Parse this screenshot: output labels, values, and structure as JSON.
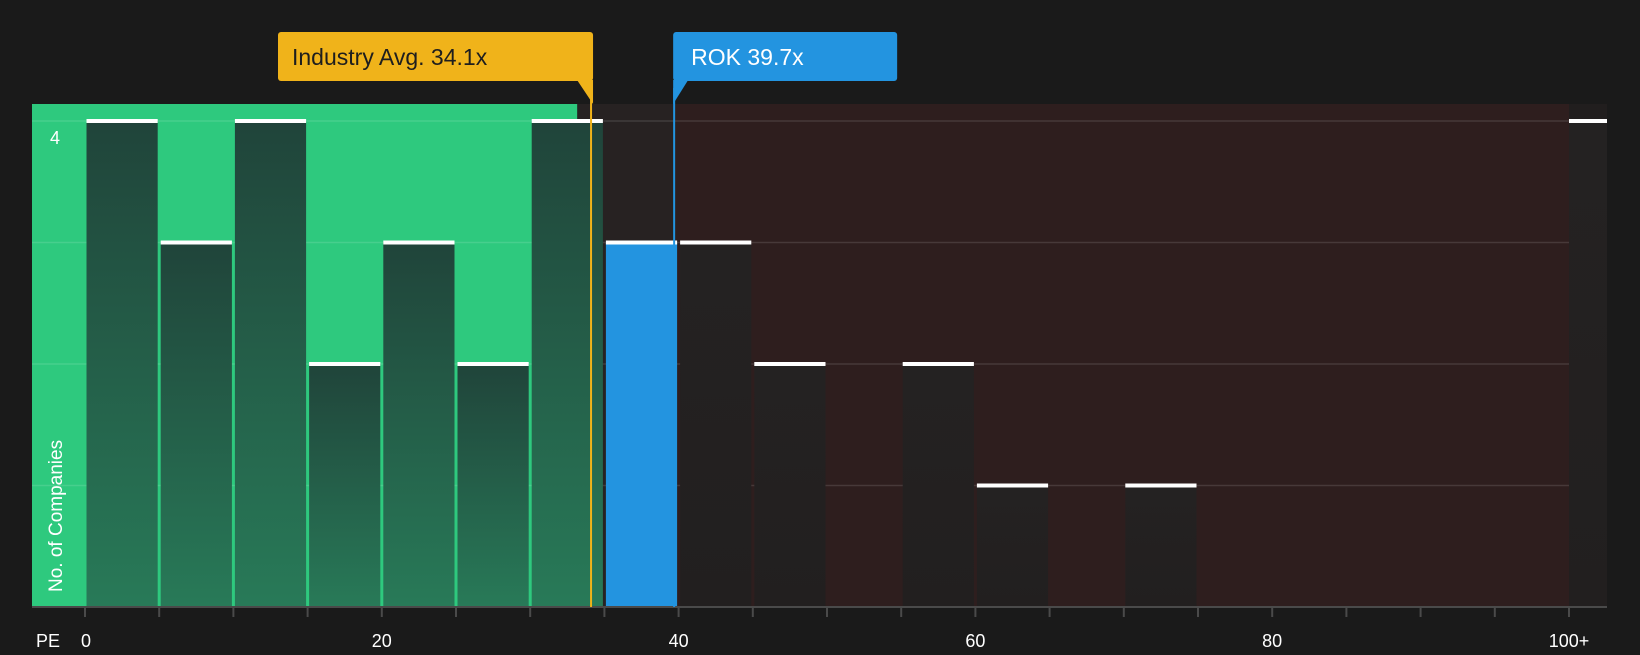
{
  "chart_data": {
    "type": "bar",
    "title": "",
    "xlabel": "PE",
    "ylabel": "No. of Companies",
    "x_ticks": [
      "0",
      "20",
      "40",
      "60",
      "80",
      "100+"
    ],
    "y_tick_labels": [
      "4"
    ],
    "ylim": [
      0,
      4
    ],
    "bin_width": 5,
    "bins": [
      {
        "start": 0,
        "count": 4,
        "zone": "below"
      },
      {
        "start": 5,
        "count": 3,
        "zone": "below"
      },
      {
        "start": 10,
        "count": 4,
        "zone": "below"
      },
      {
        "start": 15,
        "count": 2,
        "zone": "below"
      },
      {
        "start": 20,
        "count": 3,
        "zone": "below"
      },
      {
        "start": 25,
        "count": 2,
        "zone": "below"
      },
      {
        "start": 30,
        "count": 4,
        "zone": "below"
      },
      {
        "start": 35,
        "count": 3,
        "zone": "highlight"
      },
      {
        "start": 40,
        "count": 3,
        "zone": "above"
      },
      {
        "start": 45,
        "count": 2,
        "zone": "above"
      },
      {
        "start": 55,
        "count": 2,
        "zone": "above"
      },
      {
        "start": 60,
        "count": 1,
        "zone": "above"
      },
      {
        "start": 70,
        "count": 1,
        "zone": "above"
      },
      {
        "start": 100,
        "count": 4,
        "zone": "overflow"
      }
    ],
    "industry_avg": {
      "value": 34.1,
      "label": "Industry Avg. 34.1x"
    },
    "company": {
      "value": 39.7,
      "label": "ROK 39.7x"
    },
    "colors": {
      "background": "#1a1a1a",
      "green_zone": "#2ec97e",
      "red_zone": "#2e1e1e",
      "highlight": "#2394e0",
      "industry": "#f0b31a",
      "bar_white_cap": "#ffffff"
    }
  }
}
